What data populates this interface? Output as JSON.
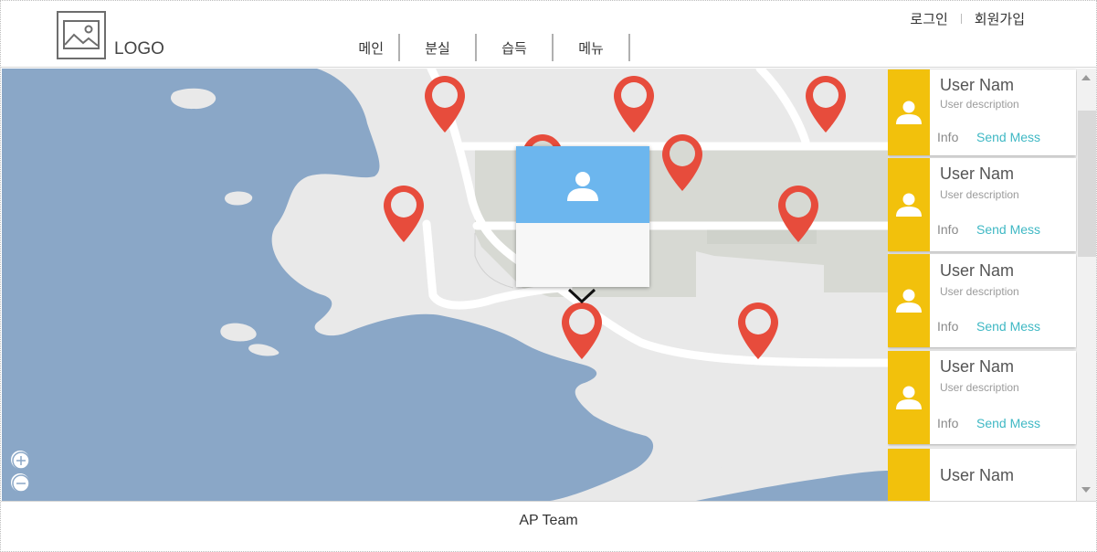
{
  "header": {
    "logo_text": "LOGO",
    "nav": [
      "메인",
      "분실",
      "습득",
      "메뉴"
    ],
    "login": "로그인",
    "signup": "회원가입"
  },
  "map": {
    "water_color": "#8aa7c7",
    "land_color": "#e9e9e9",
    "pin_color": "#e74c3c",
    "zoom_in_icon": "plus-circle-icon",
    "zoom_out_icon": "minus-circle-icon"
  },
  "popup": {
    "header_color": "#6cb6ee",
    "icon": "user-icon"
  },
  "users": [
    {
      "name": "User Nam",
      "description": "User description",
      "info": "Info",
      "send": "Send Mess"
    },
    {
      "name": "User Nam",
      "description": "User description",
      "info": "Info",
      "send": "Send Mess"
    },
    {
      "name": "User Nam",
      "description": "User description",
      "info": "Info",
      "send": "Send Mess"
    },
    {
      "name": "User Nam",
      "description": "User description",
      "info": "Info",
      "send": "Send Mess"
    },
    {
      "name": "User Nam"
    }
  ],
  "sidebar": {
    "accent_color": "#f2c10c",
    "link_color": "#3fb8c4"
  },
  "footer": {
    "text": "AP Team"
  }
}
